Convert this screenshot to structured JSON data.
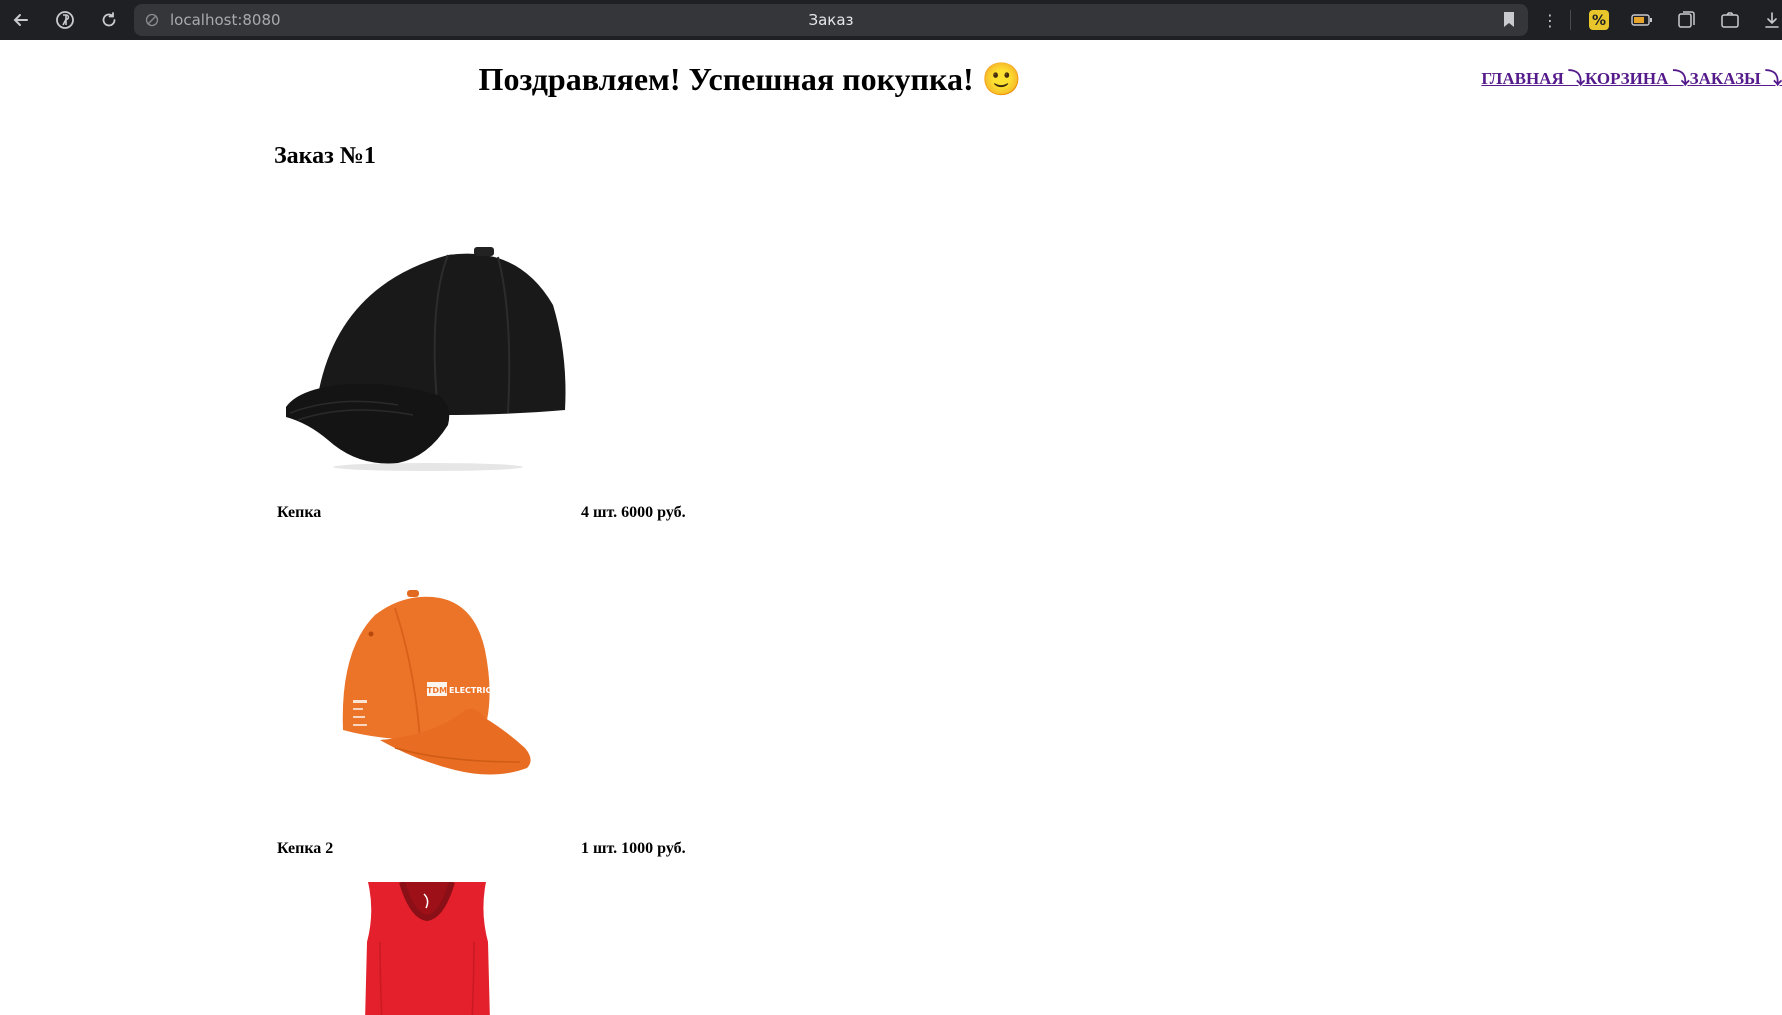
{
  "browser": {
    "url": "localhost:8080",
    "tab_title": "Заказ",
    "icons": [
      "back-icon",
      "yandex-icon",
      "reload-icon",
      "site-info-icon",
      "bookmark-icon",
      "more-icon",
      "discount-extension-icon",
      "battery-icon",
      "collections-icon",
      "screenshot-icon",
      "downloads-icon"
    ]
  },
  "page": {
    "heading": "Поздравляем! Успешная покупка! 🙂",
    "nav": [
      {
        "label": "ГЛАВНАЯ ⤵"
      },
      {
        "label": "КОРЗИНА ⤵"
      },
      {
        "label": "ЗАКАЗЫ ⤵"
      }
    ],
    "order_title": "Заказ №1"
  },
  "order_items": [
    {
      "name": "Кепка",
      "quantity_price": "4 шт. 6000 руб.",
      "image": "black-cap",
      "color": "#161616"
    },
    {
      "name": "Кепка 2",
      "quantity_price": "1 шт. 1000 руб.",
      "image": "orange-cap",
      "color": "#ec7429",
      "brand_text": "TDM ELECTRIC"
    },
    {
      "name": "",
      "quantity_price": "",
      "image": "red-tank-top",
      "color": "#e3202b"
    }
  ]
}
